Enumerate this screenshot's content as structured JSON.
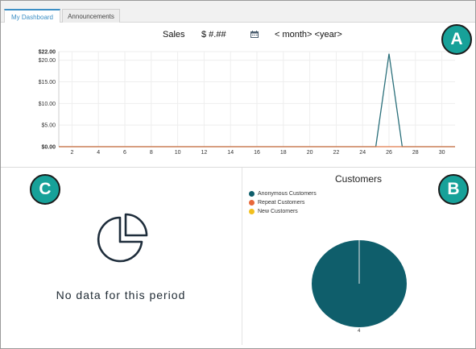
{
  "tabs": [
    {
      "label": "My Dashboard",
      "active": true
    },
    {
      "label": "Announcements",
      "active": false
    }
  ],
  "sales_header": {
    "title": "Sales",
    "amount": "$ #.##",
    "calendar_icon": "calendar-icon",
    "period": "< month> <year>"
  },
  "badges": {
    "a": "A",
    "b": "B",
    "c": "C"
  },
  "colors": {
    "accent": "#3c8fc5",
    "badge": "#17a199",
    "line": "#2a6f7a",
    "baseline": "#e07a4a",
    "anonymous": "#0f5e6b",
    "repeat": "#e8683a",
    "new": "#f2c01e"
  },
  "chart_data": {
    "type": "line",
    "x": [
      1,
      2,
      3,
      4,
      5,
      6,
      7,
      8,
      9,
      10,
      11,
      12,
      13,
      14,
      15,
      16,
      17,
      18,
      19,
      20,
      21,
      22,
      23,
      24,
      25,
      26,
      27,
      28,
      29,
      30,
      31
    ],
    "series": [
      {
        "values": [
          0,
          0,
          0,
          0,
          0,
          0,
          0,
          0,
          0,
          0,
          0,
          0,
          0,
          0,
          0,
          0,
          0,
          0,
          0,
          0,
          0,
          0,
          0,
          0,
          0,
          21.5,
          0,
          0,
          0,
          0,
          0
        ]
      }
    ],
    "x_ticks": [
      "2",
      "4",
      "6",
      "8",
      "10",
      "12",
      "14",
      "16",
      "18",
      "20",
      "22",
      "24",
      "26",
      "28",
      "30"
    ],
    "y_ticks": [
      "$0.00",
      "$5.00",
      "$10.00",
      "$15.00",
      "$20.00",
      "$22.00"
    ],
    "ylim": [
      0,
      22
    ],
    "xlim": [
      1,
      31
    ]
  },
  "empty_panel": {
    "icon": "pie-chart-outline-icon",
    "message": "No data for this period"
  },
  "customers": {
    "title": "Customers",
    "legend": [
      "Anonymous Customers",
      "Repeat Customers",
      "New Customers"
    ],
    "pie": {
      "slices": [
        {
          "label": "Anonymous Customers",
          "value": 4
        }
      ],
      "value_label": "4"
    }
  }
}
